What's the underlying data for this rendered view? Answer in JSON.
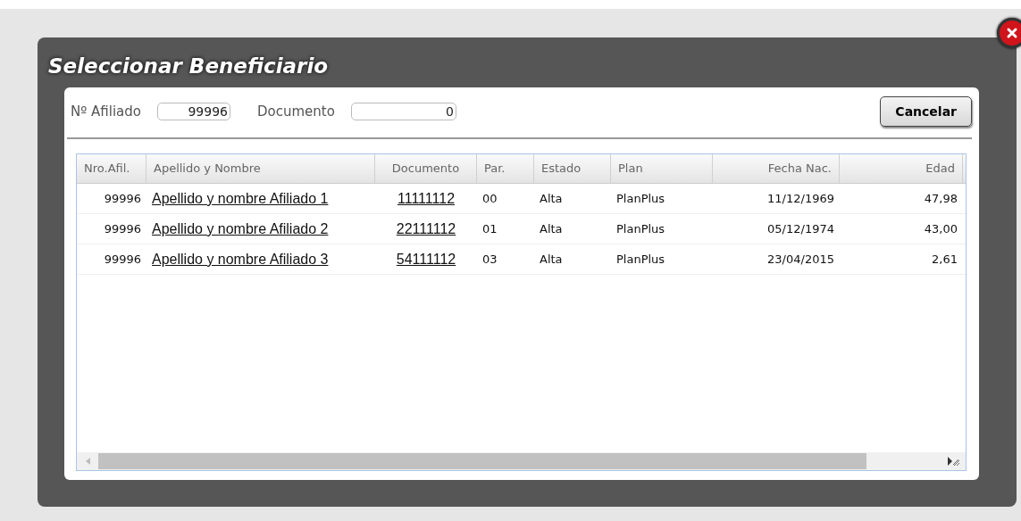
{
  "dialog": {
    "title": "Seleccionar Beneficiario"
  },
  "filters": [
    {
      "label": "Nº Afiliado",
      "value": "99996"
    },
    {
      "label": "Documento",
      "value": "0"
    }
  ],
  "cancel_button": "Cancelar",
  "table": {
    "columns": [
      "Nro.Afil.",
      "Apellido y Nombre",
      "Documento",
      "Par.",
      "Estado",
      "Plan",
      "Fecha Nac.",
      "Edad"
    ],
    "rows": [
      {
        "afiliado": "99996",
        "nombre": "Apellido y nombre Afiliado 1",
        "documento": "11111112",
        "par": "00",
        "estado": "Alta",
        "plan": "PlanPlus",
        "fecha_nac": "11/12/1969",
        "edad": "47,98"
      },
      {
        "afiliado": "99996",
        "nombre": "Apellido y nombre Afiliado 2",
        "documento": "22111112",
        "par": "01",
        "estado": "Alta",
        "plan": "PlanPlus",
        "fecha_nac": "05/12/1974",
        "edad": "43,00"
      },
      {
        "afiliado": "99996",
        "nombre": "Apellido y nombre Afiliado 3",
        "documento": "54111112",
        "par": "03",
        "estado": "Alta",
        "plan": "PlanPlus",
        "fecha_nac": "23/04/2015",
        "edad": "2,61"
      }
    ]
  }
}
